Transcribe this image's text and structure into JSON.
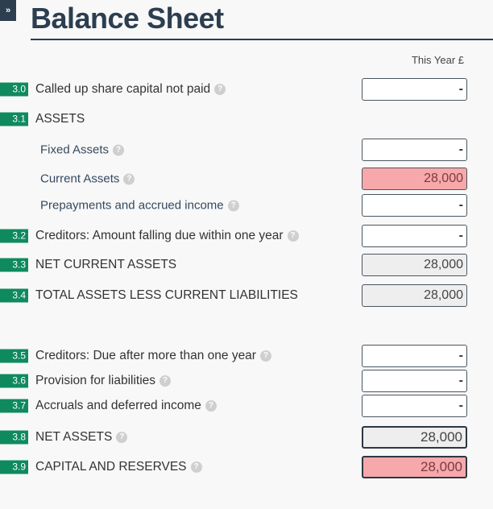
{
  "toggle": {
    "icon": "»"
  },
  "page_title": "Balance Sheet",
  "column_header": "This Year £",
  "help_glyph": "?",
  "rows": [
    {
      "code": "3.0",
      "label": "Called up share capital not paid",
      "help": true,
      "value": "-",
      "style": "input"
    },
    {
      "code": "3.1",
      "label": "ASSETS",
      "help": false,
      "value": null,
      "style": "heading"
    },
    {
      "code": null,
      "label": "Fixed Assets",
      "help": true,
      "value": "-",
      "style": "input"
    },
    {
      "code": null,
      "label": "Current Assets",
      "help": true,
      "value": "28,000",
      "style": "red"
    },
    {
      "code": null,
      "label": "Prepayments and accrued income",
      "help": true,
      "value": "-",
      "style": "input"
    },
    {
      "code": "3.2",
      "label": "Creditors: Amount falling due within one year",
      "help": true,
      "value": "-",
      "style": "input"
    },
    {
      "code": "3.3",
      "label": "NET CURRENT ASSETS",
      "help": false,
      "value": "28,000",
      "style": "grey"
    },
    {
      "code": "3.4",
      "label": "TOTAL ASSETS LESS CURRENT LIABILITIES",
      "help": false,
      "value": "28,000",
      "style": "grey"
    },
    {
      "code": "3.5",
      "label": "Creditors: Due after more than one year",
      "help": true,
      "value": "-",
      "style": "input"
    },
    {
      "code": "3.6",
      "label": "Provision for liabilities",
      "help": true,
      "value": "-",
      "style": "input"
    },
    {
      "code": "3.7",
      "label": "Accruals and deferred income",
      "help": true,
      "value": "-",
      "style": "input"
    },
    {
      "code": "3.8",
      "label": "NET ASSETS",
      "help": true,
      "value": "28,000",
      "style": "grey-bold"
    },
    {
      "code": "3.9",
      "label": "CAPITAL AND RESERVES",
      "help": true,
      "value": "28,000",
      "style": "red-bold"
    }
  ],
  "colors": {
    "badge": "#0f8a5f",
    "title": "#2c3e50",
    "highlight_red": "#f7a8ab",
    "readonly_grey": "#eeeeee"
  }
}
